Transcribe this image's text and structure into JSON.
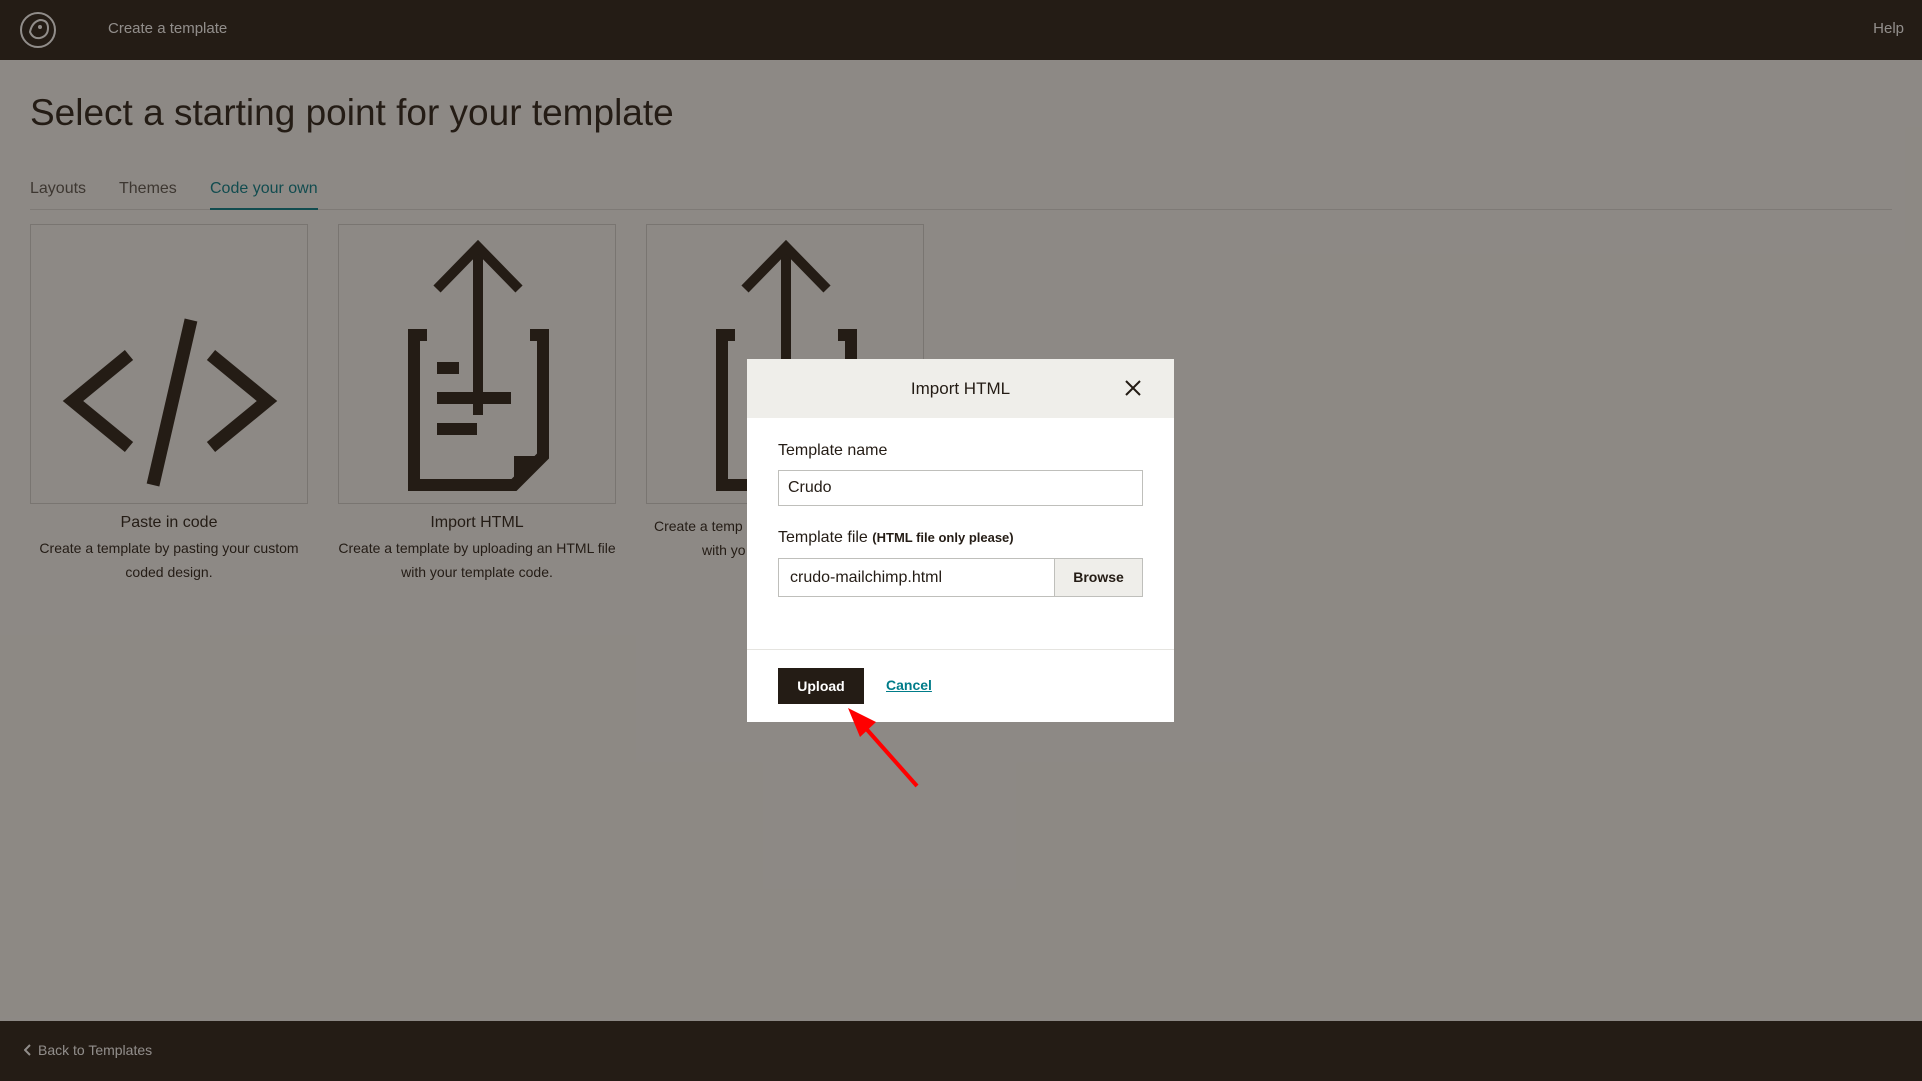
{
  "header": {
    "title": "Create a template",
    "help_label": "Help"
  },
  "main": {
    "title": "Select a starting point for your template",
    "tabs": [
      {
        "label": "Layouts"
      },
      {
        "label": "Themes"
      },
      {
        "label": "Code your own",
        "active": true
      }
    ],
    "cards": [
      {
        "title": "Paste in code",
        "desc": "Create a template by pasting your custom coded design.",
        "icon": "code-icon"
      },
      {
        "title": "Import HTML",
        "desc": "Create a template by uploading an HTML file with your template code.",
        "icon": "upload-file-icon"
      },
      {
        "title": "",
        "desc_visible_left": "Create a temp",
        "desc_visible_left2": "with yo",
        "icon": "upload-file-icon"
      }
    ]
  },
  "modal": {
    "title": "Import HTML",
    "template_name_label": "Template name",
    "template_name_value": "Crudo",
    "template_file_label": "Template file",
    "template_file_hint": "(HTML file only please)",
    "file_name": "crudo-mailchimp.html",
    "browse_label": "Browse",
    "upload_label": "Upload",
    "cancel_label": "Cancel"
  },
  "footer": {
    "back_label": "Back to Templates"
  },
  "colors": {
    "accent": "#007c89",
    "dark": "#241c15",
    "annotation_arrow": "#ff0000"
  }
}
